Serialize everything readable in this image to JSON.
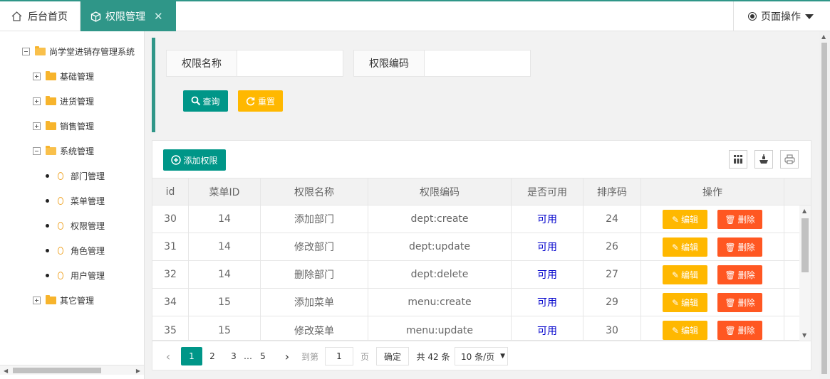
{
  "tabs": {
    "home_label": "后台首页",
    "active_label": "权限管理",
    "close_glyph": "✕"
  },
  "page_ops": {
    "label": "页面操作"
  },
  "tree": {
    "root": "尚学堂进销存管理系统",
    "nodes": [
      {
        "label": "基础管理",
        "expanded": false
      },
      {
        "label": "进货管理",
        "expanded": false
      },
      {
        "label": "销售管理",
        "expanded": false
      },
      {
        "label": "系统管理",
        "expanded": true
      },
      {
        "label": "其它管理",
        "expanded": false
      }
    ],
    "system_children": [
      "部门管理",
      "菜单管理",
      "权限管理",
      "角色管理",
      "用户管理"
    ]
  },
  "search": {
    "name_label": "权限名称",
    "name_value": "",
    "code_label": "权限编码",
    "code_value": "",
    "query_label": "查询",
    "reset_label": "重置"
  },
  "table": {
    "add_label": "添加权限",
    "toolbar_icons": [
      "columns-icon",
      "export-icon",
      "print-icon"
    ],
    "columns": [
      "id",
      "菜单ID",
      "权限名称",
      "权限编码",
      "是否可用",
      "排序码",
      "操作"
    ],
    "rows": [
      {
        "id": "30",
        "menu_id": "14",
        "name": "添加部门",
        "code": "dept:create",
        "available": "可用",
        "sort": "24"
      },
      {
        "id": "31",
        "menu_id": "14",
        "name": "修改部门",
        "code": "dept:update",
        "available": "可用",
        "sort": "26"
      },
      {
        "id": "32",
        "menu_id": "14",
        "name": "删除部门",
        "code": "dept:delete",
        "available": "可用",
        "sort": "27"
      },
      {
        "id": "34",
        "menu_id": "15",
        "name": "添加菜单",
        "code": "menu:create",
        "available": "可用",
        "sort": "29"
      },
      {
        "id": "35",
        "menu_id": "15",
        "name": "修改菜单",
        "code": "menu:update",
        "available": "可用",
        "sort": "30"
      }
    ],
    "edit_label": "编辑",
    "delete_label": "删除"
  },
  "pager": {
    "pages": [
      "1",
      "2",
      "3",
      "…",
      "5"
    ],
    "current": "1",
    "goto_label": "到第",
    "goto_value": "1",
    "page_unit": "页",
    "confirm_label": "确定",
    "total_text": "共 42 条",
    "per_page": "10 条/页"
  },
  "colors": {
    "primary": "#009688",
    "warning": "#ffb800",
    "danger": "#ff5722",
    "available_text": "#0000cc"
  }
}
